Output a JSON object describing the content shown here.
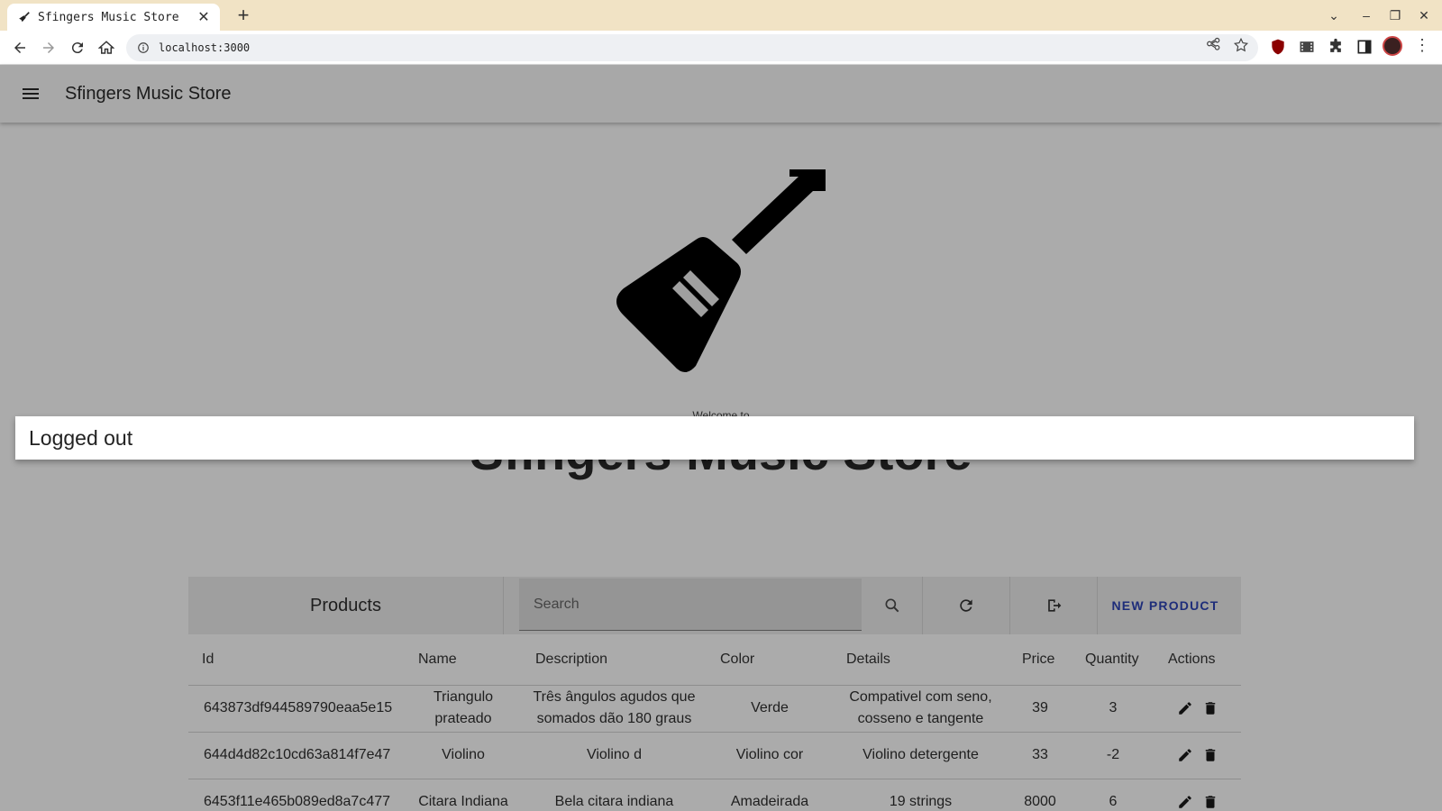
{
  "browser": {
    "tab_title": "Sfingers Music Store",
    "url": "localhost:3000"
  },
  "app": {
    "title": "Sfingers Music Store",
    "welcome": "Welcome to",
    "hero_title": "Sfingers Music Store"
  },
  "snackbar": {
    "message": "Logged out"
  },
  "products": {
    "title": "Products",
    "search_placeholder": "Search",
    "new_button": "NEW PRODUCT",
    "columns": [
      "Id",
      "Name",
      "Description",
      "Color",
      "Details",
      "Price",
      "Quantity",
      "Actions"
    ],
    "rows": [
      {
        "id": "643873df944589790eaa5e15",
        "name": "Triangulo prateado",
        "description": "Três ângulos agudos que somados dão 180 graus",
        "color": "Verde",
        "details": "Compativel com seno, cosseno e tangente",
        "price": "39",
        "quantity": "3"
      },
      {
        "id": "644d4d82c10cd63a814f7e47",
        "name": "Violino",
        "description": "Violino d",
        "color": "Violino cor",
        "details": "Violino detergente",
        "price": "33",
        "quantity": "-2"
      },
      {
        "id": "6453f11e465b089ed8a7c477",
        "name": "Citara Indiana",
        "description": "Bela citara indiana",
        "color": "Amadeirada",
        "details": "19 strings",
        "price": "8000",
        "quantity": "6"
      }
    ]
  },
  "colors": {
    "overlay_background": "#ababab",
    "tabstrip": "#f1e3c5",
    "new_product_text": "#1e2d7a"
  }
}
